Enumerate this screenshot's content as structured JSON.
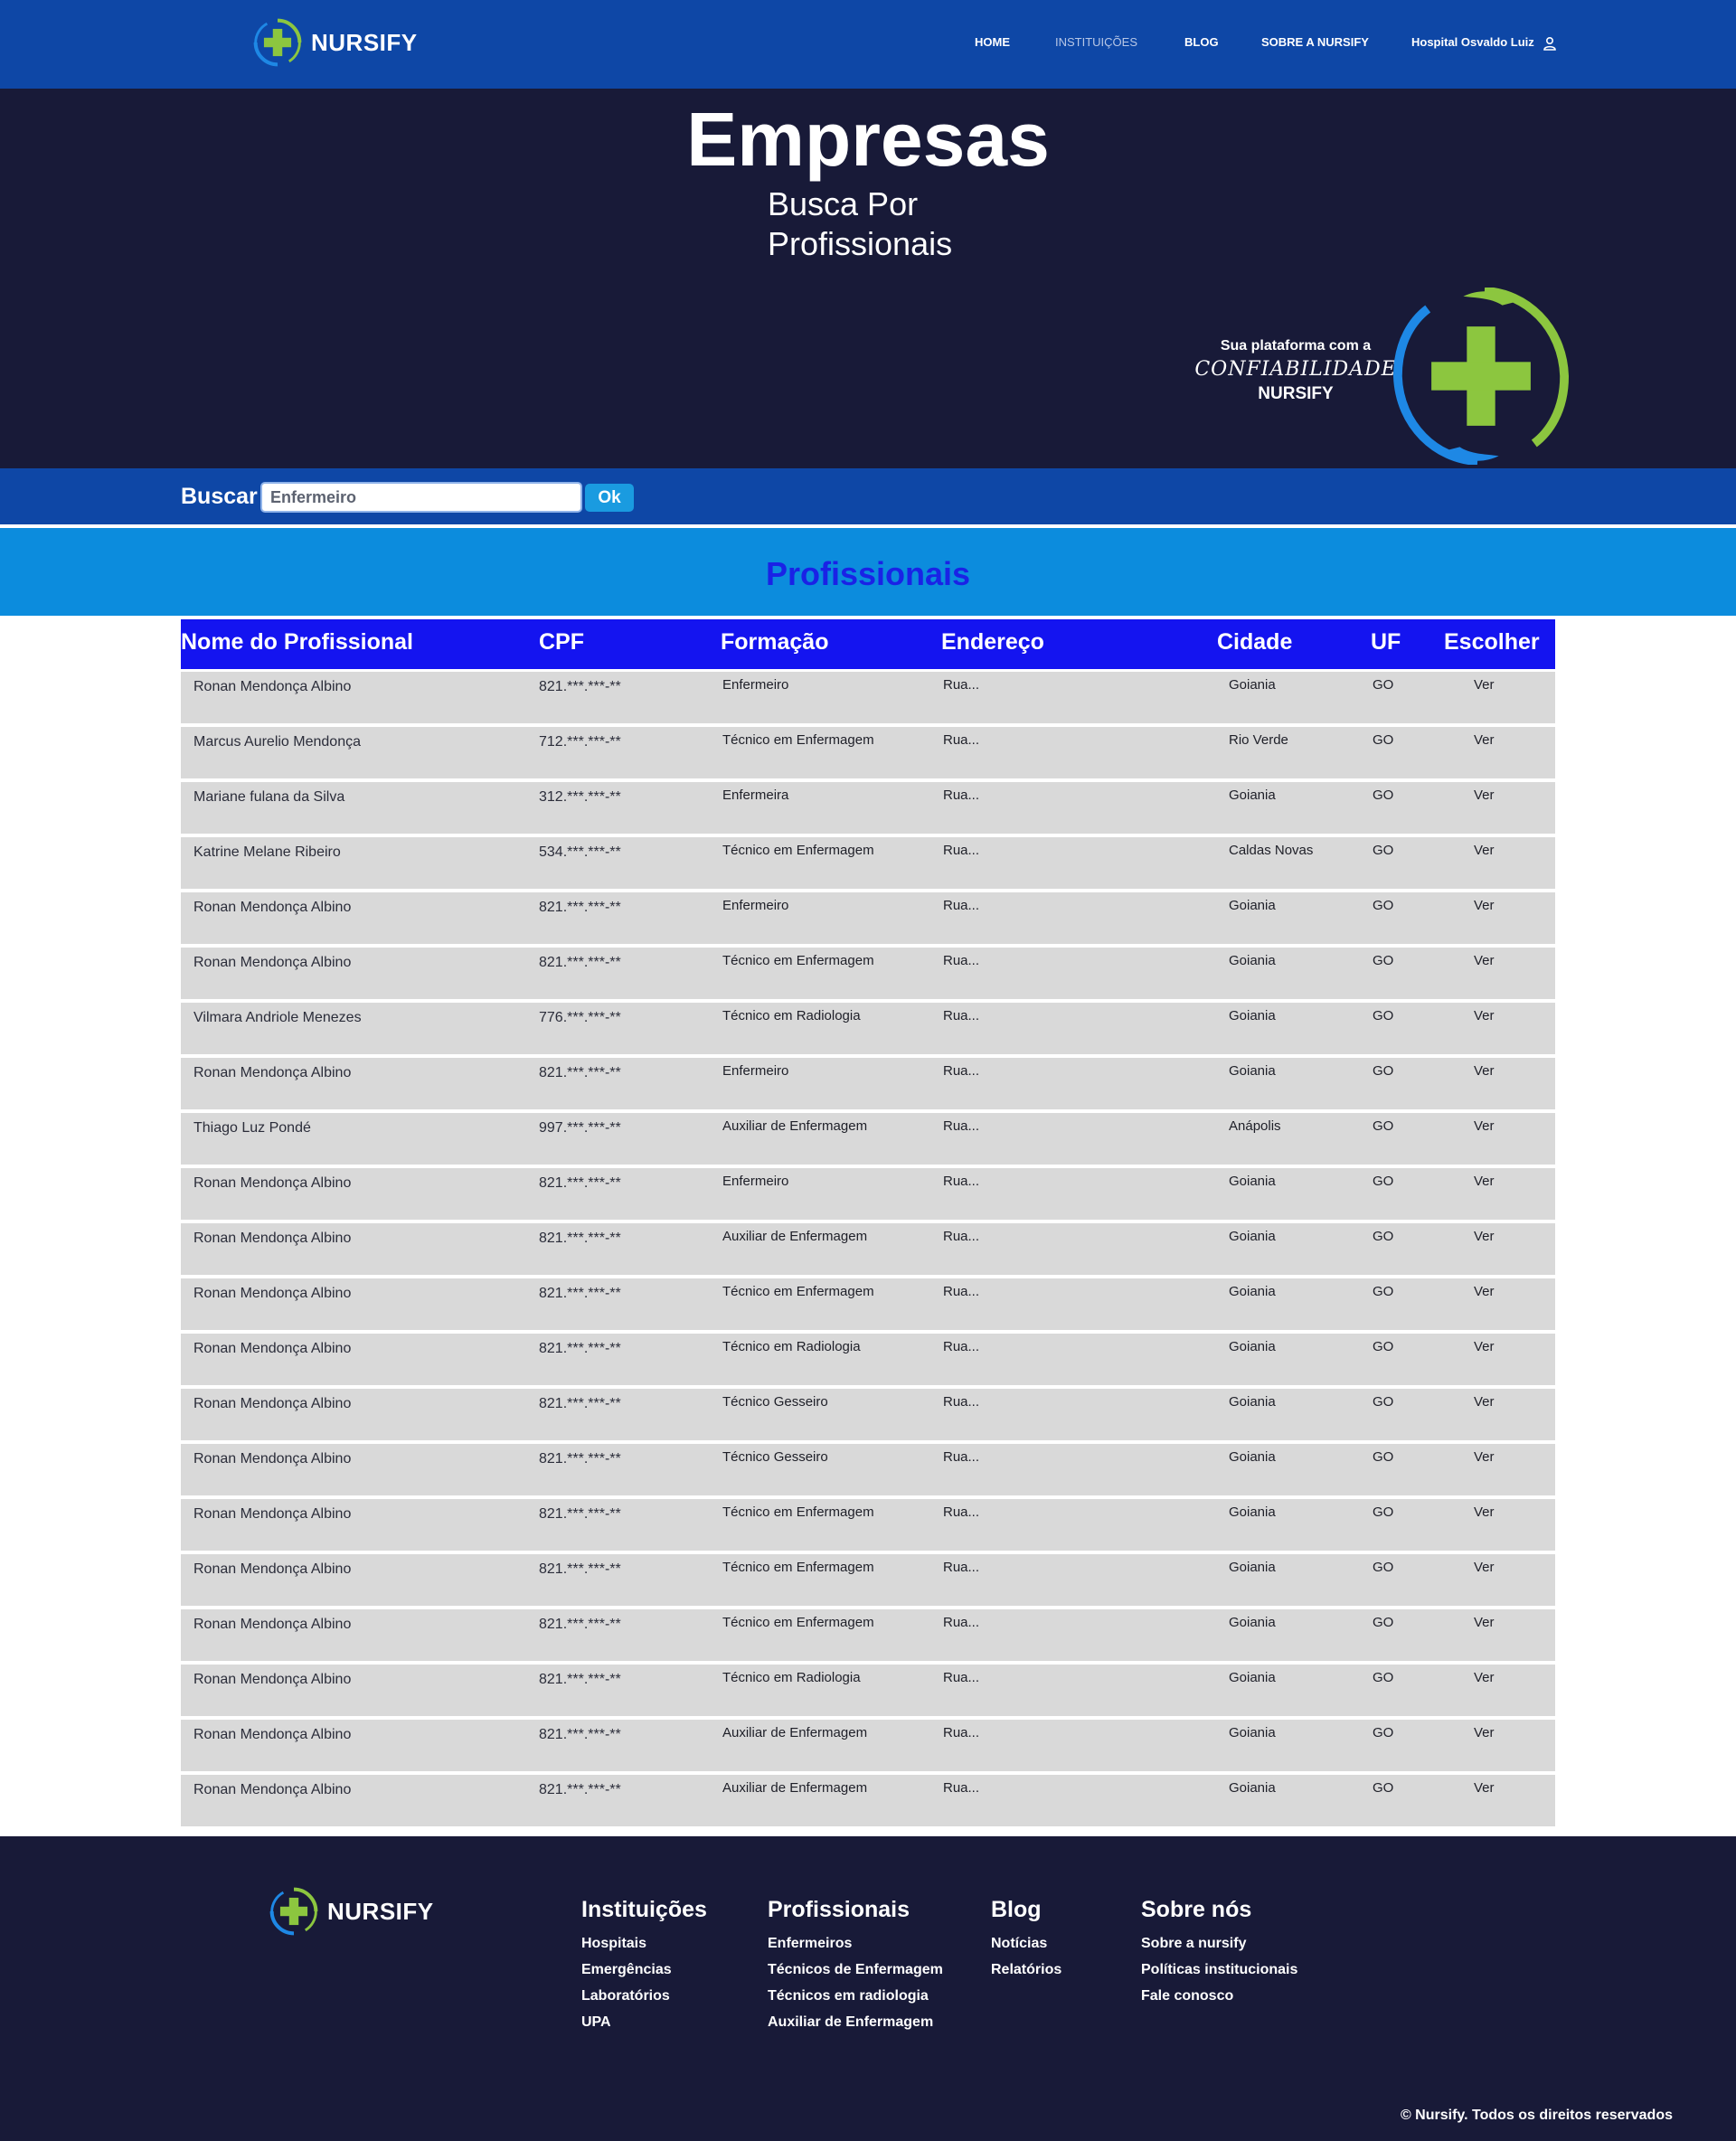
{
  "brand": {
    "name": "NURSIFY"
  },
  "nav": {
    "home": "HOME",
    "instituicoes": "INSTITUIÇÕES",
    "blog": "BLOG",
    "sobre": "SOBRE A NURSIFY",
    "user": "Hospital Osvaldo Luiz"
  },
  "hero": {
    "title": "Empresas",
    "subtitle_line1": "Busca Por",
    "subtitle_line2": "Profissionais",
    "tagline_line1": "Sua plataforma com a",
    "tagline_line2": "CONFIABILIDADE",
    "tagline_line3": "NURSIFY"
  },
  "search": {
    "label": "Buscar",
    "value": "Enfermeiro",
    "button": "Ok"
  },
  "section": {
    "title": "Profissionais"
  },
  "table": {
    "headers": {
      "nome": "Nome do Profissional",
      "cpf": "CPF",
      "formacao": "Formação",
      "endereco": "Endereço",
      "cidade": "Cidade",
      "uf": "UF",
      "escolher": "Escolher"
    },
    "rows": [
      {
        "nome": "Ronan Mendonça Albino",
        "cpf": "821.***.***-**",
        "formacao": "Enfermeiro",
        "endereco": "Rua...",
        "cidade": "Goiania",
        "uf": "GO",
        "acao": "Ver"
      },
      {
        "nome": "Marcus Aurelio Mendonça",
        "cpf": "712.***.***-**",
        "formacao": "Técnico em Enfermagem",
        "endereco": "Rua...",
        "cidade": "Rio Verde",
        "uf": "GO",
        "acao": "Ver"
      },
      {
        "nome": "Mariane fulana da Silva",
        "cpf": "312.***.***-**",
        "formacao": "Enfermeira",
        "endereco": "Rua...",
        "cidade": "Goiania",
        "uf": "GO",
        "acao": "Ver"
      },
      {
        "nome": "Katrine Melane Ribeiro",
        "cpf": "534.***.***-**",
        "formacao": "Técnico em Enfermagem",
        "endereco": "Rua...",
        "cidade": "Caldas Novas",
        "uf": "GO",
        "acao": "Ver"
      },
      {
        "nome": "Ronan Mendonça Albino",
        "cpf": "821.***.***-**",
        "formacao": "Enfermeiro",
        "endereco": "Rua...",
        "cidade": "Goiania",
        "uf": "GO",
        "acao": "Ver"
      },
      {
        "nome": "Ronan Mendonça Albino",
        "cpf": "821.***.***-**",
        "formacao": "Técnico em Enfermagem",
        "endereco": "Rua...",
        "cidade": "Goiania",
        "uf": "GO",
        "acao": "Ver"
      },
      {
        "nome": "Vilmara Andriole Menezes",
        "cpf": "776.***.***-**",
        "formacao": "Técnico em Radiologia",
        "endereco": "Rua...",
        "cidade": "Goiania",
        "uf": "GO",
        "acao": "Ver"
      },
      {
        "nome": "Ronan Mendonça Albino",
        "cpf": "821.***.***-**",
        "formacao": "Enfermeiro",
        "endereco": "Rua...",
        "cidade": "Goiania",
        "uf": "GO",
        "acao": "Ver"
      },
      {
        "nome": "Thiago Luz Pondé",
        "cpf": "997.***.***-**",
        "formacao": "Auxiliar de Enfermagem",
        "endereco": "Rua...",
        "cidade": "Anápolis",
        "uf": "GO",
        "acao": "Ver"
      },
      {
        "nome": "Ronan Mendonça Albino",
        "cpf": "821.***.***-**",
        "formacao": "Enfermeiro",
        "endereco": "Rua...",
        "cidade": "Goiania",
        "uf": "GO",
        "acao": "Ver"
      },
      {
        "nome": "Ronan Mendonça Albino",
        "cpf": "821.***.***-**",
        "formacao": "Auxiliar de Enfermagem",
        "endereco": "Rua...",
        "cidade": "Goiania",
        "uf": "GO",
        "acao": "Ver"
      },
      {
        "nome": "Ronan Mendonça Albino",
        "cpf": "821.***.***-**",
        "formacao": "Técnico em Enfermagem",
        "endereco": "Rua...",
        "cidade": "Goiania",
        "uf": "GO",
        "acao": "Ver"
      },
      {
        "nome": "Ronan Mendonça Albino",
        "cpf": "821.***.***-**",
        "formacao": "Técnico em Radiologia",
        "endereco": "Rua...",
        "cidade": "Goiania",
        "uf": "GO",
        "acao": "Ver"
      },
      {
        "nome": "Ronan Mendonça Albino",
        "cpf": "821.***.***-**",
        "formacao": "Técnico Gesseiro",
        "endereco": "Rua...",
        "cidade": "Goiania",
        "uf": "GO",
        "acao": "Ver"
      },
      {
        "nome": "Ronan Mendonça Albino",
        "cpf": "821.***.***-**",
        "formacao": "Técnico Gesseiro",
        "endereco": "Rua...",
        "cidade": "Goiania",
        "uf": "GO",
        "acao": "Ver"
      },
      {
        "nome": "Ronan Mendonça Albino",
        "cpf": "821.***.***-**",
        "formacao": "Técnico em Enfermagem",
        "endereco": "Rua...",
        "cidade": "Goiania",
        "uf": "GO",
        "acao": "Ver"
      },
      {
        "nome": "Ronan Mendonça Albino",
        "cpf": "821.***.***-**",
        "formacao": "Técnico em Enfermagem",
        "endereco": "Rua...",
        "cidade": "Goiania",
        "uf": "GO",
        "acao": "Ver"
      },
      {
        "nome": "Ronan Mendonça Albino",
        "cpf": "821.***.***-**",
        "formacao": "Técnico em Enfermagem",
        "endereco": "Rua...",
        "cidade": "Goiania",
        "uf": "GO",
        "acao": "Ver"
      },
      {
        "nome": "Ronan Mendonça Albino",
        "cpf": "821.***.***-**",
        "formacao": "Técnico em Radiologia",
        "endereco": "Rua...",
        "cidade": "Goiania",
        "uf": "GO",
        "acao": "Ver"
      },
      {
        "nome": "Ronan Mendonça Albino",
        "cpf": "821.***.***-**",
        "formacao": "Auxiliar de Enfermagem",
        "endereco": "Rua...",
        "cidade": "Goiania",
        "uf": "GO",
        "acao": "Ver"
      },
      {
        "nome": "Ronan Mendonça Albino",
        "cpf": "821.***.***-**",
        "formacao": "Auxiliar de Enfermagem",
        "endereco": "Rua...",
        "cidade": "Goiania",
        "uf": "GO",
        "acao": "Ver"
      }
    ]
  },
  "footer": {
    "columns": [
      {
        "title": "Instituições",
        "links": [
          "Hospitais",
          "Emergências",
          "Laboratórios",
          "UPA"
        ]
      },
      {
        "title": "Profissionais",
        "links": [
          "Enfermeiros",
          "Técnicos de Enfermagem",
          "Técnicos em radiologia",
          "Auxiliar de Enfermagem"
        ]
      },
      {
        "title": "Blog",
        "links": [
          "Notícias",
          "Relatórios"
        ]
      },
      {
        "title": "Sobre nós",
        "links": [
          "Sobre a nursify",
          "Políticas institucionais",
          "Fale conosco"
        ]
      }
    ],
    "copyright": "© Nursify. Todos os direitos reservados"
  },
  "colors": {
    "nav_blue": "#0e47a6",
    "dark_navy": "#181a38",
    "header_blue": "#1414f0",
    "section_blue": "#0c8cdd",
    "accent_green": "#8cc63f",
    "row_gray": "#d9d9d9"
  },
  "icons": {
    "logo": "medical-cross-hands-icon",
    "user": "user-icon"
  }
}
